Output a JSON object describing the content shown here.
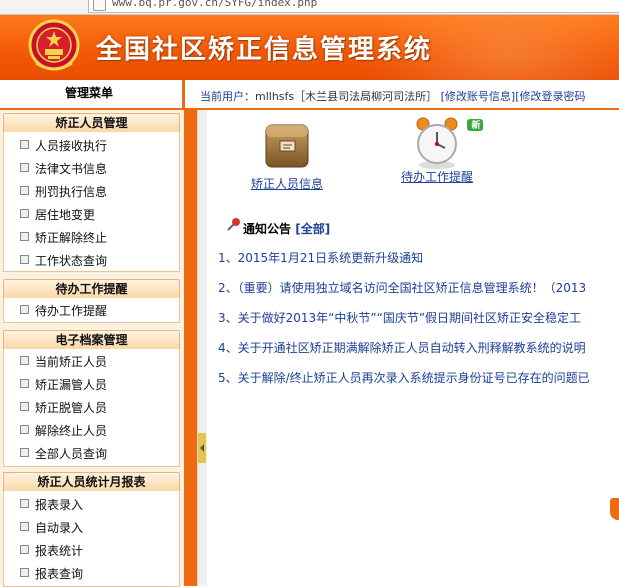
{
  "browser": {
    "url": "www.bq.pr.gov.cn/SYFG/index.php"
  },
  "header": {
    "title": "全国社区矫正信息管理系统"
  },
  "infobar": {
    "menu_title": "管理菜单",
    "user_label": "当前用户：",
    "user_value": "mllhsfs［木兰县司法局柳河司法所］",
    "link_account": "[修改账号信息]",
    "link_password": "[修改登录密码"
  },
  "sidebar": {
    "groups": [
      {
        "title": "矫正人员管理",
        "items": [
          "人员接收执行",
          "法律文书信息",
          "刑罚执行信息",
          "居住地变更",
          "矫正解除终止",
          "工作状态查询"
        ]
      },
      {
        "title": "待办工作提醒",
        "items": [
          "待办工作提醒"
        ]
      },
      {
        "title": "电子档案管理",
        "items": [
          "当前矫正人员",
          "矫正漏管人员",
          "矫正脱管人员",
          "解除终止人员",
          "全部人员查询"
        ]
      },
      {
        "title": "矫正人员统计月报表",
        "items": [
          "报表录入",
          "自动录入",
          "报表统计",
          "报表查询"
        ]
      }
    ]
  },
  "main": {
    "quick_links": [
      {
        "label": "矫正人员信息",
        "icon": "archive-box-icon"
      },
      {
        "label": "待办工作提醒",
        "icon": "alarm-clock-icon",
        "badge": "新"
      }
    ],
    "notice": {
      "title": "通知公告",
      "all_link": "[全部]"
    },
    "notices": [
      {
        "num": "1、",
        "text": "2015年1月21日系统更新升级通知"
      },
      {
        "num": "2、",
        "text": "（重要）请使用独立域名访问全国社区矫正信息管理系统！（2013"
      },
      {
        "num": "3、",
        "text": "关于做好2013年“中秋节”“国庆节”假日期间社区矫正安全稳定工"
      },
      {
        "num": "4、",
        "text": "关于开通社区矫正期满解除矫正人员自动转入刑释解教系统的说明"
      },
      {
        "num": "5、",
        "text": "关于解除/终止矫正人员再次录入系统提示身份证号已存在的问题已"
      }
    ]
  },
  "colors": {
    "brand": "#f35a08",
    "link": "#1c3f99"
  }
}
